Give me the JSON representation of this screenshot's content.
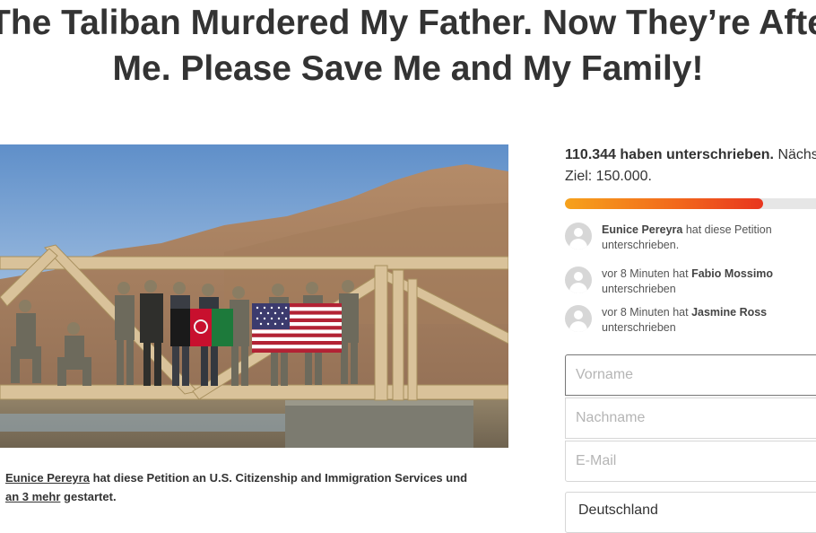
{
  "petition": {
    "title_line1": "The Taliban Murdered My Father. Now They’re After",
    "title_line2": "Me. Please Save Me and My Family!",
    "starter": {
      "name": "Eunice Pereyra",
      "text": " hat diese Petition an U.S. Citizenship and Immigration Services und ",
      "more_link": "an 3 mehr",
      "suffix": " gestartet."
    }
  },
  "signatures": {
    "count_text": "110.344 haben unterschrieben.",
    "next_goal_text": " Nächs",
    "goal_text": "Ziel: 150.000.",
    "progress_fraction": 0.7356
  },
  "recent_signers": [
    {
      "prefix": "",
      "name": "Eunice Pereyra",
      "suffix": " hat diese Petition unterschrieben."
    },
    {
      "prefix": "vor 8 Minuten hat ",
      "name": "Fabio Mossimo",
      "suffix": " unterschrieben"
    },
    {
      "prefix": "vor 8 Minuten hat ",
      "name": "Jasmine Ross",
      "suffix": " unterschrieben"
    }
  ],
  "form": {
    "first_name_placeholder": "Vorname",
    "last_name_placeholder": "Nachname",
    "email_placeholder": "E-Mail",
    "country_value": "Deutschland"
  },
  "colors": {
    "progress_start": "#f6a21c",
    "progress_end": "#e8361f",
    "text": "#333333"
  }
}
